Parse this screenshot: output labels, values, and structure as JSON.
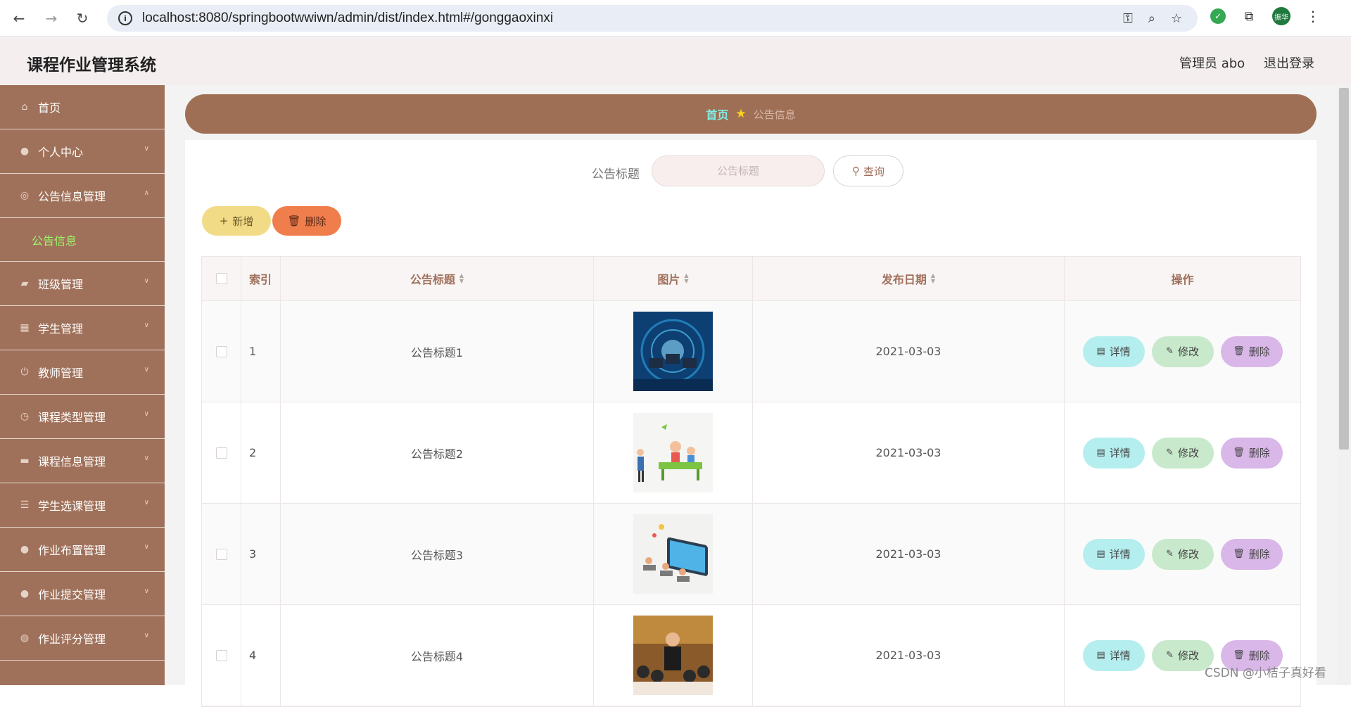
{
  "browser": {
    "url": "localhost:8080/springbootwwiwn/admin/dist/index.html#/gonggaoxinxi",
    "profile_label": "振华"
  },
  "header": {
    "app_title": "课程作业管理系统",
    "user_label": "管理员 abo",
    "logout_label": "退出登录"
  },
  "sidebar": {
    "items": [
      {
        "label": "首页",
        "icon": "home-icon"
      },
      {
        "label": "个人中心",
        "icon": "user-icon"
      },
      {
        "label": "公告信息管理",
        "icon": "notice-icon",
        "expanded": true,
        "children": [
          {
            "label": "公告信息"
          }
        ]
      },
      {
        "label": "班级管理",
        "icon": "class-icon"
      },
      {
        "label": "学生管理",
        "icon": "grid-icon"
      },
      {
        "label": "教师管理",
        "icon": "power-icon"
      },
      {
        "label": "课程类型管理",
        "icon": "clock-icon"
      },
      {
        "label": "课程信息管理",
        "icon": "ticket-icon"
      },
      {
        "label": "学生选课管理",
        "icon": "list-icon"
      },
      {
        "label": "作业布置管理",
        "icon": "location-icon"
      },
      {
        "label": "作业提交管理",
        "icon": "user-icon"
      },
      {
        "label": "作业评分管理",
        "icon": "globe-icon"
      }
    ]
  },
  "breadcrumb": {
    "home": "首页",
    "current": "公告信息"
  },
  "search": {
    "label": "公告标题",
    "placeholder": "公告标题",
    "button": "查询"
  },
  "actions": {
    "add": "新增",
    "delete": "删除"
  },
  "table": {
    "headers": {
      "index": "索引",
      "title": "公告标题",
      "image": "图片",
      "date": "发布日期",
      "ops": "操作"
    },
    "rows": [
      {
        "index": "1",
        "title": "公告标题1",
        "date": "2021-03-03"
      },
      {
        "index": "2",
        "title": "公告标题2",
        "date": "2021-03-03"
      },
      {
        "index": "3",
        "title": "公告标题3",
        "date": "2021-03-03"
      },
      {
        "index": "4",
        "title": "公告标题4",
        "date": "2021-03-03"
      }
    ],
    "row_buttons": {
      "detail": "详情",
      "edit": "修改",
      "delete": "删除"
    }
  },
  "watermark": "CSDN @小桔子真好看",
  "colors": {
    "sidebar_bg": "#a0715a",
    "breadcrumb_bg": "#9f6f55",
    "submenu_active": "#9df56b",
    "add_button": "#f2db87",
    "delete_button": "#f07d4c",
    "detail_button": "#b5eeee",
    "edit_button": "#c8e9cc",
    "row_delete_button": "#d9b7e8"
  }
}
